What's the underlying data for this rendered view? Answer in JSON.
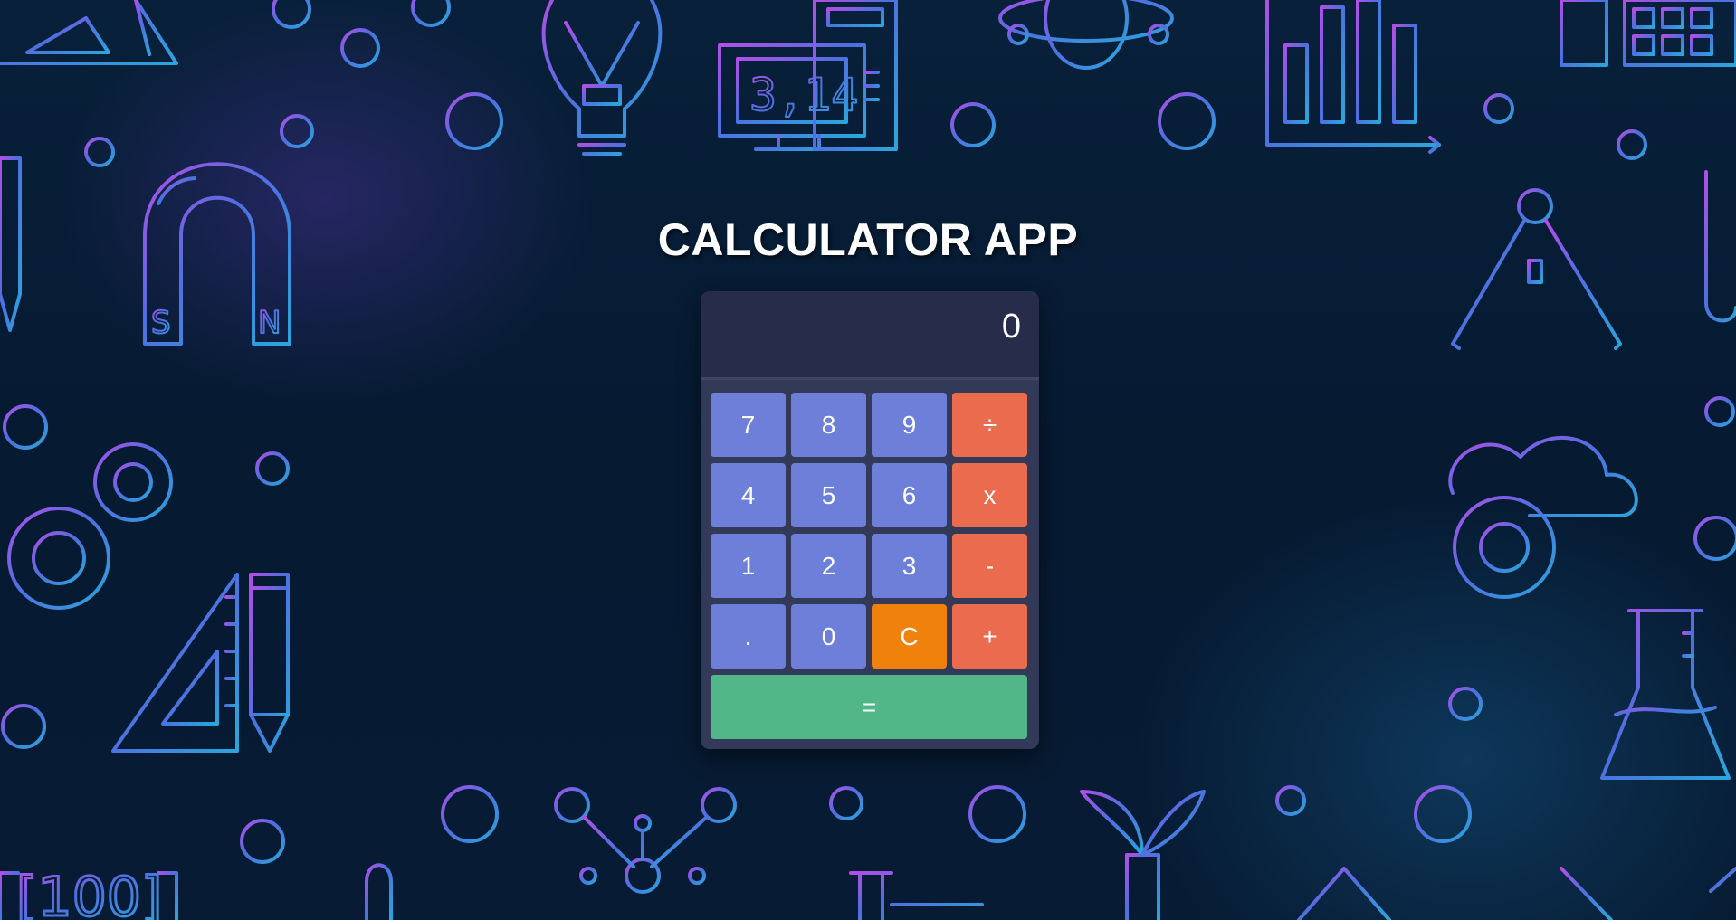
{
  "app": {
    "title": "CALCULATOR APP"
  },
  "display": {
    "value": "0"
  },
  "keys": {
    "row1": [
      "7",
      "8",
      "9",
      "÷"
    ],
    "row2": [
      "4",
      "5",
      "6",
      "x"
    ],
    "row3": [
      "1",
      "2",
      "3",
      "-"
    ],
    "row4": [
      ".",
      "0",
      "C",
      "+"
    ],
    "equals": "="
  },
  "background": {
    "magnet_labels": [
      "S",
      "N"
    ],
    "monitor_text": "3,14",
    "number_row": "[100]"
  },
  "colors": {
    "number_key": "#6d7fd9",
    "operator_key": "#eb6b4f",
    "clear_key": "#f0820c",
    "equals_key": "#52b788",
    "display": "#272c4b",
    "panel": "#333a58"
  }
}
